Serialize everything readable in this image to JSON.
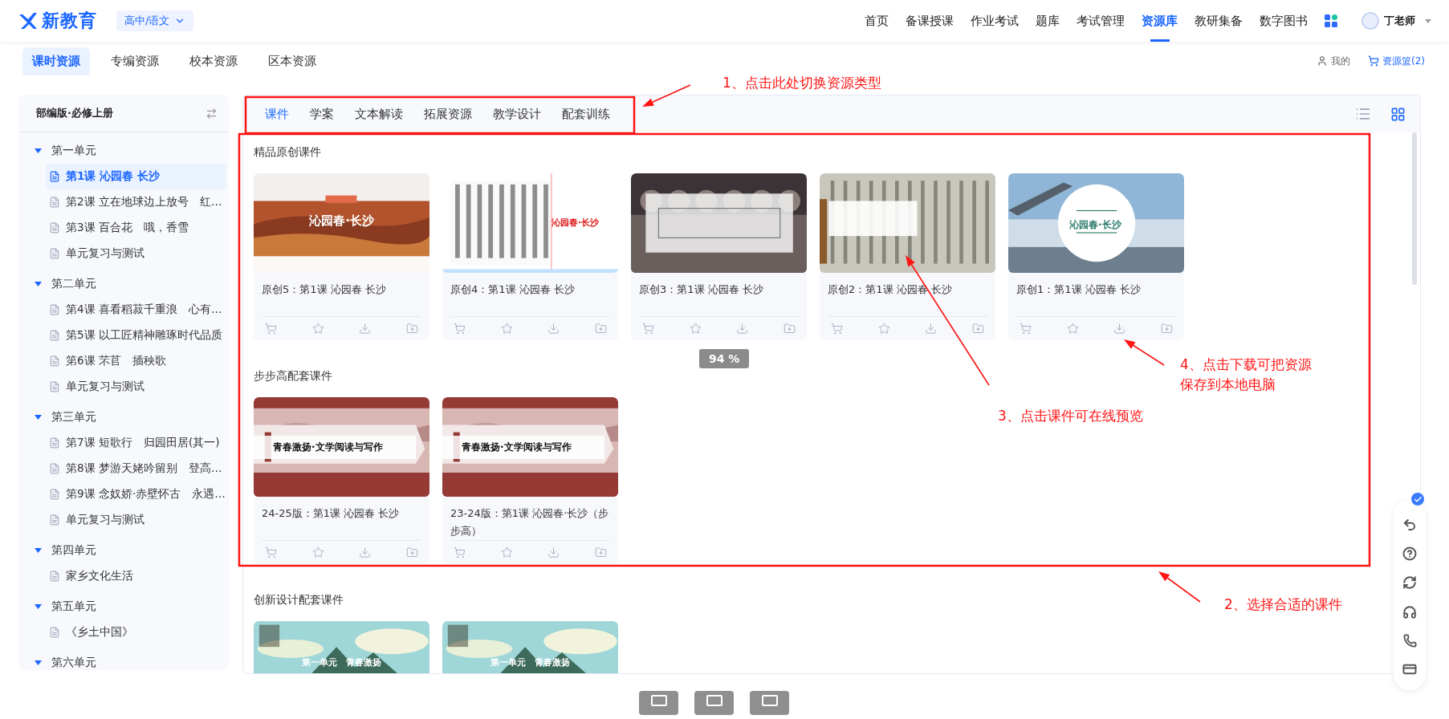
{
  "logo": {
    "text": "新教育"
  },
  "grade_selector": {
    "label": "高中/语文"
  },
  "nav": [
    {
      "label": "首页",
      "selected": false
    },
    {
      "label": "备课授课",
      "selected": false
    },
    {
      "label": "作业考试",
      "selected": false
    },
    {
      "label": "题库",
      "selected": false
    },
    {
      "label": "考试管理",
      "selected": false
    },
    {
      "label": "资源库",
      "selected": true
    },
    {
      "label": "教研集备",
      "selected": false
    },
    {
      "label": "数字图书",
      "selected": false
    }
  ],
  "user": {
    "name": "丁老师"
  },
  "resource_tabs": [
    {
      "label": "课时资源",
      "selected": true
    },
    {
      "label": "专编资源",
      "selected": false
    },
    {
      "label": "校本资源",
      "selected": false
    },
    {
      "label": "区本资源",
      "selected": false
    }
  ],
  "my_link": "我的",
  "basket": "资源篮(2)",
  "sidebar": {
    "title": "部编版·必修上册",
    "units": [
      {
        "label": "第一单元",
        "expanded": true,
        "children": [
          {
            "label": "第1课 沁园春 长沙",
            "selected": true
          },
          {
            "label": "第2课 立在地球边上放号　红…",
            "selected": false
          },
          {
            "label": "第3课 百合花　哦，香雪",
            "selected": false
          },
          {
            "label": "单元复习与测试",
            "selected": false
          }
        ]
      },
      {
        "label": "第二单元",
        "expanded": true,
        "children": [
          {
            "label": "第4课 喜看稻菽千重浪　心有…",
            "selected": false
          },
          {
            "label": "第5课 以工匠精神雕琢时代品质",
            "selected": false
          },
          {
            "label": "第6课 芣苢　插秧歌",
            "selected": false
          },
          {
            "label": "单元复习与测试",
            "selected": false
          }
        ]
      },
      {
        "label": "第三单元",
        "expanded": true,
        "children": [
          {
            "label": "第7课 短歌行　归园田居(其一)",
            "selected": false
          },
          {
            "label": "第8课 梦游天姥吟留别　登高…",
            "selected": false
          },
          {
            "label": "第9课 念奴娇·赤壁怀古　永遇…",
            "selected": false
          },
          {
            "label": "单元复习与测试",
            "selected": false
          }
        ]
      },
      {
        "label": "第四单元",
        "expanded": true,
        "children": [
          {
            "label": "家乡文化生活",
            "selected": false
          }
        ]
      },
      {
        "label": "第五单元",
        "expanded": true,
        "children": [
          {
            "label": "《乡土中国》",
            "selected": false
          }
        ]
      },
      {
        "label": "第六单元",
        "expanded": true
      }
    ]
  },
  "type_tabs": [
    {
      "label": "课件",
      "selected": true
    },
    {
      "label": "学案",
      "selected": false
    },
    {
      "label": "文本解读",
      "selected": false
    },
    {
      "label": "拓展资源",
      "selected": false
    },
    {
      "label": "教学设计",
      "selected": false
    },
    {
      "label": "配套训练",
      "selected": false
    }
  ],
  "sections": [
    {
      "title": "精品原创课件",
      "cards": [
        {
          "title": "原创5：第1课 沁园春 长沙",
          "slide_title": "沁园春·长沙"
        },
        {
          "title": "原创4：第1课 沁园春 长沙",
          "slide_title": "沁园春·长沙"
        },
        {
          "title": "原创3：第1课 沁园春 长沙"
        },
        {
          "title": "原创2：第1课 沁园春 长沙"
        },
        {
          "title": "原创1：第1课 沁园春 长沙",
          "slide_title": "沁园春·长沙"
        }
      ]
    },
    {
      "title": "步步高配套课件",
      "cards": [
        {
          "title": "24-25版：第1课 沁园春 长沙",
          "slide_title": "青春激扬·文学阅读与写作"
        },
        {
          "title": "23-24版：第1课 沁园春·长沙（步步高）",
          "slide_title": "青春激扬·文学阅读与写作"
        }
      ]
    },
    {
      "title": "创新设计配套课件",
      "cards": [
        {
          "slide_title": "第一单元　青春激扬"
        },
        {
          "slide_title": "第一单元　青春激扬"
        }
      ]
    }
  ],
  "zoom_badge": "94 %",
  "annotations": [
    {
      "text": "1、点击此处切换资源类型"
    },
    {
      "text": "2、选择合适的课件"
    },
    {
      "text": "3、点击课件可在线预览"
    },
    {
      "text": "4、点击下载可把资源保存到本地电脑"
    }
  ]
}
